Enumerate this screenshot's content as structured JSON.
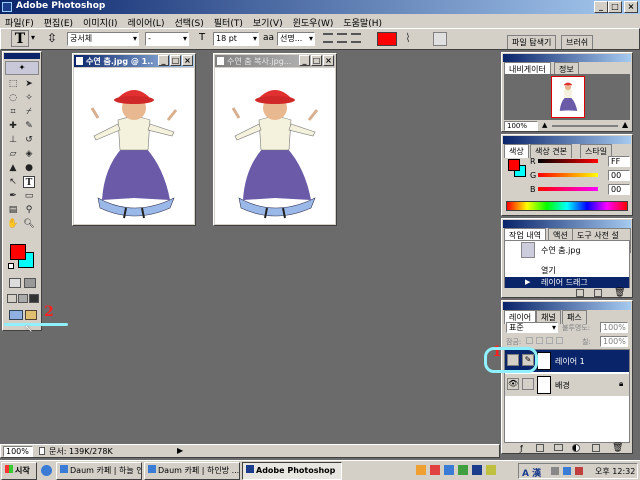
{
  "app": {
    "title": "Adobe Photoshop"
  },
  "menu": [
    "파일(F)",
    "편집(E)",
    "이미지(I)",
    "레이어(L)",
    "선택(S)",
    "필터(T)",
    "보기(V)",
    "윈도우(W)",
    "도움말(H)"
  ],
  "options": {
    "font_family": "궁서체",
    "font_style": "-",
    "font_size": "18 pt",
    "antialias": "선명...",
    "palette_tabs": [
      "파일 탐색기",
      "브러쉬"
    ]
  },
  "documents": [
    {
      "title": "수연 춤.jpg @ 1..."
    },
    {
      "title": "수연 춤 복사.jpg..."
    }
  ],
  "navigator": {
    "tabs": [
      "내비게이터",
      "정보"
    ],
    "zoom": "100%"
  },
  "color_panel": {
    "tabs": [
      "색상",
      "색상 견본",
      "스타일"
    ],
    "channels": [
      {
        "label": "R",
        "value": "FF"
      },
      {
        "label": "G",
        "value": "00"
      },
      {
        "label": "B",
        "value": "00"
      }
    ],
    "foreground": "#ff0000",
    "background": "#00ffff"
  },
  "history": {
    "tabs": [
      "작업 내역",
      "액션",
      "도구 사전 설정"
    ],
    "snapshot": "수연 춤.jpg",
    "items": [
      "열기",
      "레이어 드래그"
    ]
  },
  "layers": {
    "tabs": [
      "레이어",
      "채널",
      "패스"
    ],
    "blend_mode": "표준",
    "opacity_label": "불투명도:",
    "opacity": "100%",
    "lock_label": "잠금:",
    "fill_label": "칠:",
    "fill": "100%",
    "items": [
      "레이어 1",
      "배경"
    ]
  },
  "statusbar": {
    "zoom": "100%",
    "doc": "문서: 139K/278K"
  },
  "annotations": {
    "one": "1",
    "two": "2"
  },
  "taskbar": {
    "start": "시작",
    "tasks": [
      "Daum 카페 | 하늘 인...",
      "Daum 카페 | 하인방 ...",
      "Adobe Photoshop"
    ],
    "tray_lang": "A 漢",
    "clock": "오후 12:32"
  }
}
